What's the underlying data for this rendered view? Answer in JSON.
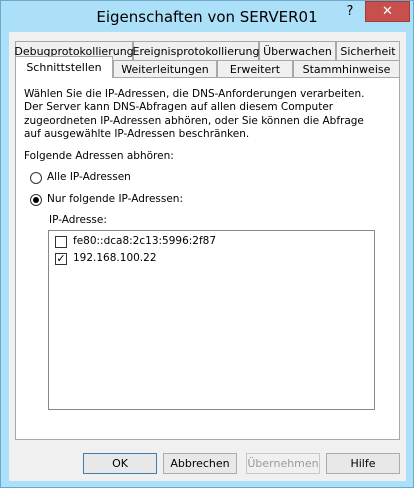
{
  "window": {
    "title": "Eigenschaften von SERVER01",
    "help_glyph": "?",
    "close_glyph": "✕"
  },
  "tabs_row1": [
    "Debugprotokollierung",
    "Ereignisprotokollierung",
    "Überwachen",
    "Sicherheit"
  ],
  "tabs_row2": [
    "Schnittstellen",
    "Weiterleitungen",
    "Erweitert",
    "Stammhinweise"
  ],
  "description": "Wählen Sie die IP-Adressen, die DNS-Anforderungen verarbeiten. Der Server kann DNS-Abfragen auf allen diesem Computer zugeordneten IP-Adressen abhören, oder Sie können die Abfrage auf ausgewählte IP-Adressen beschränken.",
  "listen_label": "Folgende Adressen abhören:",
  "radio_all": {
    "label": "Alle IP-Adressen",
    "selected": false
  },
  "radio_only": {
    "label": "Nur folgende IP-Adressen:",
    "selected": true
  },
  "ip_label": "IP-Adresse:",
  "ip_list": [
    {
      "address": "fe80::dca8:2c13:5996:2f87",
      "checked": false
    },
    {
      "address": "192.168.100.22",
      "checked": true
    }
  ],
  "buttons": {
    "ok": "OK",
    "cancel": "Abbrechen",
    "apply": "Übernehmen",
    "help": "Hilfe"
  }
}
